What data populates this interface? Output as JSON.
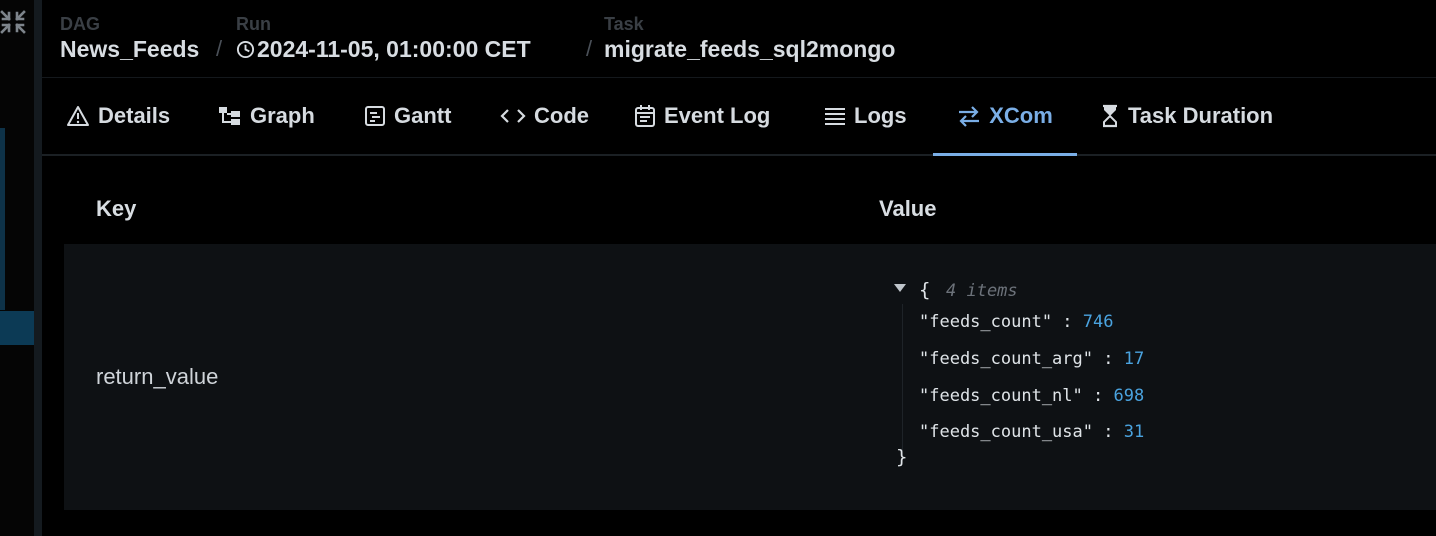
{
  "breadcrumb": {
    "dag_label": "DAG",
    "dag_value": "News_Feeds",
    "run_label": "Run",
    "run_value": "2024-11-05, 01:00:00 CET",
    "task_label": "Task",
    "task_value": "migrate_feeds_sql2mongo",
    "separator": "/"
  },
  "tabs": [
    {
      "label": "Details",
      "icon": "warning-triangle-icon"
    },
    {
      "label": "Graph",
      "icon": "graph-icon"
    },
    {
      "label": "Gantt",
      "icon": "gantt-icon"
    },
    {
      "label": "Code",
      "icon": "code-icon"
    },
    {
      "label": "Event Log",
      "icon": "calendar-icon"
    },
    {
      "label": "Logs",
      "icon": "lines-icon"
    },
    {
      "label": "XCom",
      "icon": "swap-arrows-icon",
      "active": true
    },
    {
      "label": "Task Duration",
      "icon": "hourglass-icon"
    }
  ],
  "table": {
    "headers": {
      "key": "Key",
      "value": "Value"
    },
    "rows": [
      {
        "key": "return_value",
        "value": {
          "items_label": "4 items",
          "entries": [
            {
              "key": "\"feeds_count\"",
              "value": "746"
            },
            {
              "key": "\"feeds_count_arg\"",
              "value": "17"
            },
            {
              "key": "\"feeds_count_nl\"",
              "value": "698"
            },
            {
              "key": "\"feeds_count_usa\"",
              "value": "31"
            }
          ]
        }
      }
    ]
  },
  "colors": {
    "background": "#000000",
    "active_tab": "#7aaee6",
    "json_number": "#4aa3df",
    "row_background": "#0e1114"
  }
}
